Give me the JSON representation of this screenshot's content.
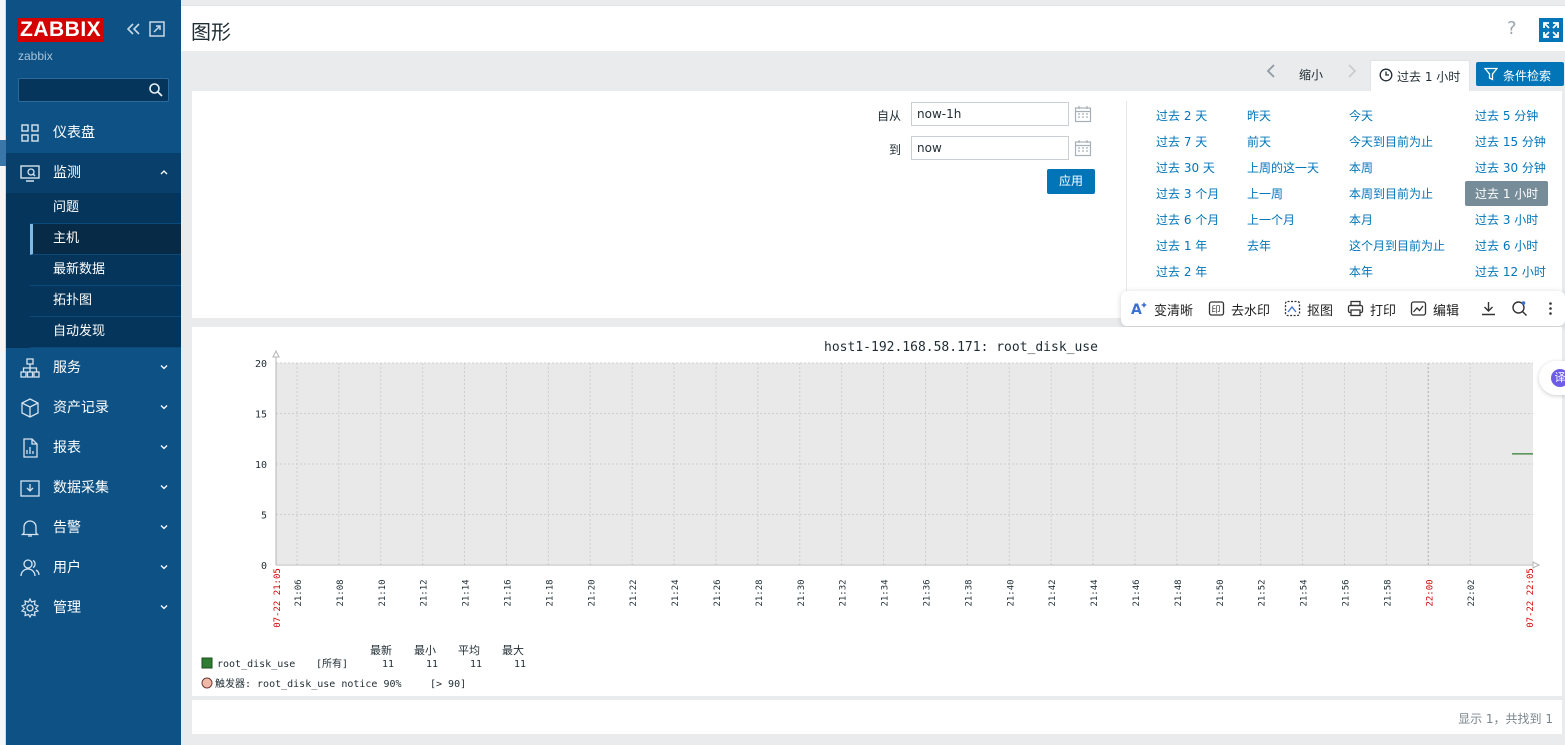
{
  "sidebar": {
    "logo": "ZABBIX",
    "server_name": "zabbix",
    "nav": [
      {
        "label": "仪表盘"
      },
      {
        "label": "监测"
      },
      {
        "label": "服务"
      },
      {
        "label": "资产记录"
      },
      {
        "label": "报表"
      },
      {
        "label": "数据采集"
      },
      {
        "label": "告警"
      },
      {
        "label": "用户"
      },
      {
        "label": "管理"
      }
    ],
    "submenu": [
      "问题",
      "主机",
      "最新数据",
      "拓扑图",
      "自动发现"
    ],
    "submenu_active": "主机"
  },
  "header": {
    "title": "图形",
    "help": "?"
  },
  "filterbar": {
    "zoom_out": "缩小",
    "time_tab": "过去 1 小时",
    "filter_tab": "条件检索"
  },
  "timepanel": {
    "from_label": "自从",
    "from_value": "now-1h",
    "to_label": "到",
    "to_value": "now",
    "apply": "应用",
    "quick_ranges": [
      [
        "过去 2 天",
        "过去 7 天",
        "过去 30 天",
        "过去 3 个月",
        "过去 6 个月",
        "过去 1 年",
        "过去 2 年"
      ],
      [
        "昨天",
        "前天",
        "上周的这一天",
        "上一周",
        "上一个月",
        "去年"
      ],
      [
        "今天",
        "今天到目前为止",
        "本周",
        "本周到目前为止",
        "本月",
        "这个月到目前为止",
        "本年"
      ],
      [
        "过去 5 分钟",
        "过去 15 分钟",
        "过去 30 分钟",
        "过去 1 小时",
        "过去 3 小时",
        "过去 6 小时",
        "过去 12 小时"
      ]
    ],
    "selected_range": "过去 1 小时"
  },
  "float_toolbar": {
    "items": [
      "变清晰",
      "去水印",
      "抠图",
      "打印",
      "编辑"
    ]
  },
  "translate_badge": "译",
  "graph": {
    "legend": {
      "headers": [
        "最新",
        "最小",
        "平均",
        "最大"
      ],
      "item_name": "root_disk_use",
      "item_scope": "[所有]",
      "item_values": [
        "11",
        "11",
        "11",
        "11"
      ],
      "trigger_label": "触发器: root_disk_use notice 90%",
      "trigger_cond": "[> 90]"
    }
  },
  "chart_data": {
    "type": "line",
    "title": "host1-192.168.58.171: root_disk_use",
    "ylim": [
      0,
      20
    ],
    "y_ticks": [
      0,
      5,
      10,
      15,
      20
    ],
    "x_start_label": "07-22 21:05",
    "x_end_label": "07-22 22:05",
    "x_ticks": [
      "21:06",
      "21:08",
      "21:10",
      "21:12",
      "21:14",
      "21:16",
      "21:18",
      "21:20",
      "21:22",
      "21:24",
      "21:26",
      "21:28",
      "21:30",
      "21:32",
      "21:34",
      "21:36",
      "21:38",
      "21:40",
      "21:42",
      "21:44",
      "21:46",
      "21:48",
      "21:50",
      "21:52",
      "21:54",
      "21:56",
      "21:58",
      "22:00",
      "22:02"
    ],
    "x_tick_highlight": "22:00",
    "grid": true,
    "series": [
      {
        "name": "root_disk_use",
        "color": "#2e7d32",
        "points": [
          [
            "22:04",
            11
          ],
          [
            "22:05",
            11
          ]
        ]
      }
    ]
  },
  "footer": {
    "text": "显示 1，共找到 1"
  }
}
